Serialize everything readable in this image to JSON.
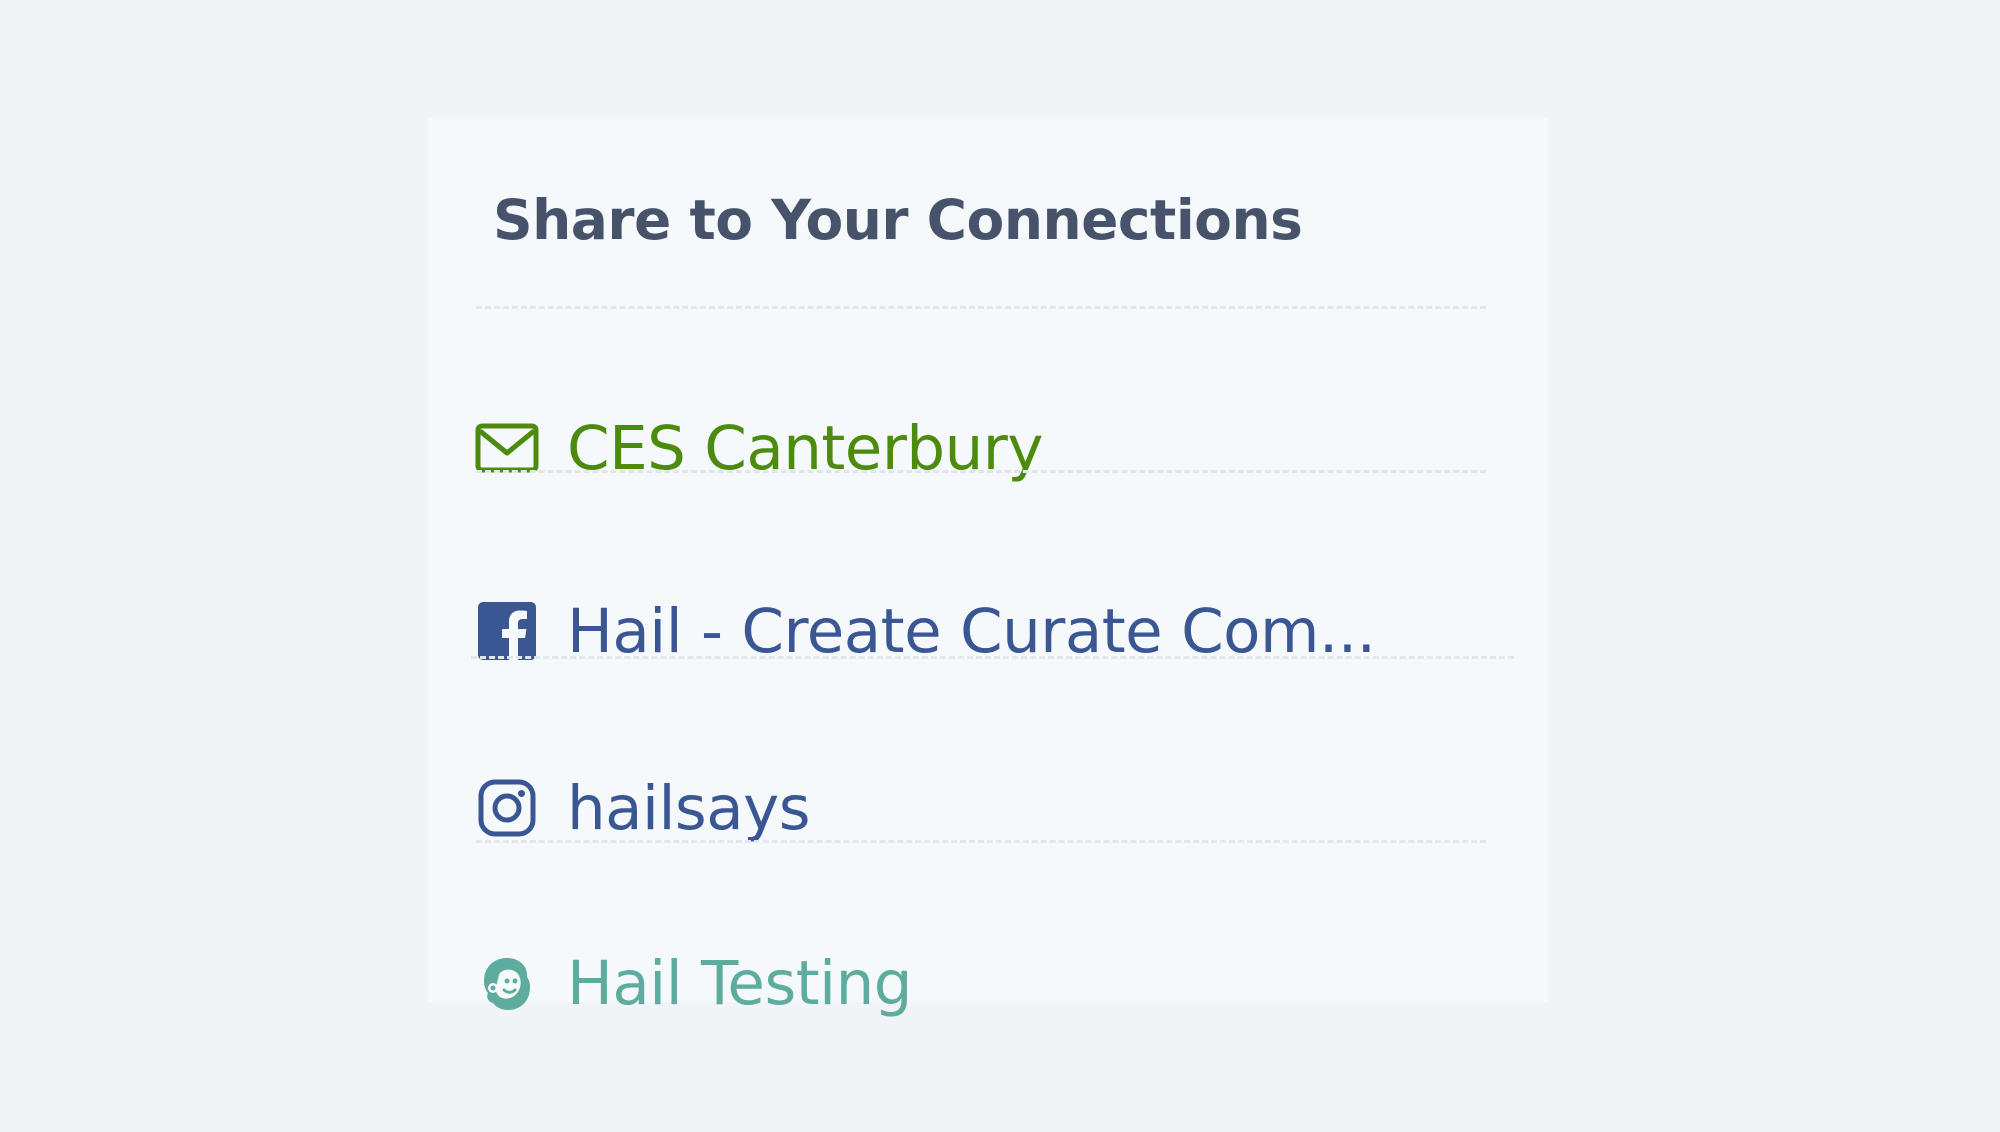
{
  "panel": {
    "title": "Share to Your Connections"
  },
  "connections": [
    {
      "label": "CES Canterbury",
      "icon": "envelope-icon",
      "color": "#4c8b0d"
    },
    {
      "label": "Hail - Create Curate Com...",
      "icon": "facebook-icon",
      "color": "#3a5693"
    },
    {
      "label": "hailsays",
      "icon": "instagram-icon",
      "color": "#3a5693"
    },
    {
      "label": "Hail Testing",
      "icon": "mailchimp-icon",
      "color": "#5eac9d"
    }
  ],
  "colors": {
    "background": "#f1f4f7",
    "panel": "#f6f9fb",
    "title": "#46536a",
    "divider": "#e3e7ec"
  }
}
